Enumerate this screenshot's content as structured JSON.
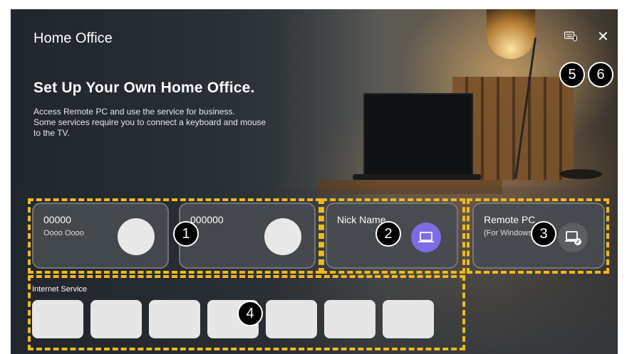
{
  "app": {
    "title": "Home Office"
  },
  "hero": {
    "headline": "Set Up Your Own Home Office.",
    "description_lines": [
      "Access Remote PC and use the service for business.",
      "Some services require you to connect a keyboard and mouse",
      "to the TV."
    ]
  },
  "toolbar": {
    "keyboard_icon": "keyboard-mouse-icon",
    "close_icon": "close-icon"
  },
  "devices": [
    {
      "name": "00000",
      "subtitle": "Oooo Oooo"
    },
    {
      "name": "000000",
      "subtitle": ""
    },
    {
      "name": "Nick Name",
      "icon": "laptop-icon"
    },
    {
      "name": "Remote PC",
      "subtitle": "(For Windows)",
      "icon": "remote-pc-icon"
    }
  ],
  "internet_service": {
    "label": "Internet Service",
    "tile_count": 7
  },
  "callouts": [
    "1",
    "2",
    "3",
    "4",
    "5",
    "6"
  ],
  "colors": {
    "highlight": "#f0b81a",
    "accent": "#7e6be6"
  }
}
